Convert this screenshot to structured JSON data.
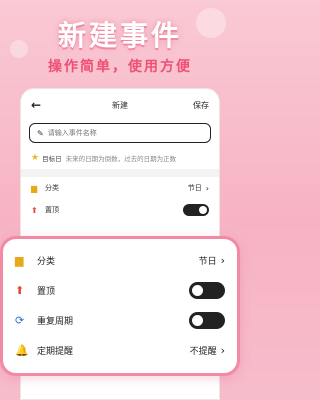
{
  "promo": {
    "title": "新建事件",
    "subtitle": "操作简单，使用方便"
  },
  "header": {
    "title": "新建",
    "save_label": "保存"
  },
  "name_field": {
    "placeholder": "请输入事件名称"
  },
  "target_day": {
    "label": "目标日",
    "hint": "未来的日期为倒数，过去的日期为正数"
  },
  "mini_settings": [
    {
      "label": "分类",
      "value": "节日"
    },
    {
      "label": "置顶"
    }
  ],
  "zoom_settings": {
    "category": {
      "label": "分类",
      "value": "节日"
    },
    "pin": {
      "label": "置顶"
    },
    "repeat": {
      "label": "重复周期"
    },
    "reminder": {
      "label": "定期提醒",
      "value": "不提醒"
    }
  },
  "colors": {
    "accent": "#f28aa5",
    "subtitle": "#ef4f74"
  }
}
